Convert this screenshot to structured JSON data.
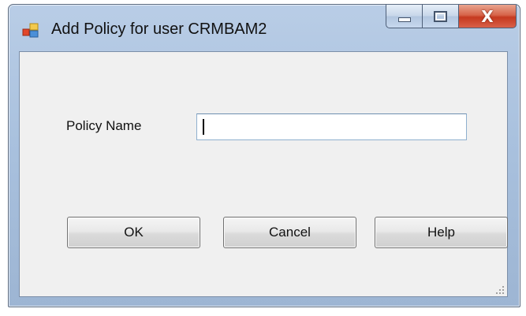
{
  "window": {
    "title": "Add Policy for user CRMBAM2"
  },
  "caption_buttons": {
    "minimize_icon": "minimize-icon",
    "maximize_icon": "maximize-icon",
    "close_icon": "close-icon",
    "close_glyph": "X"
  },
  "form": {
    "policy_label": "Policy Name",
    "policy_value": "",
    "policy_placeholder": ""
  },
  "buttons": {
    "ok_label": "OK",
    "cancel_label": "Cancel",
    "help_label": "Help"
  },
  "colors": {
    "frame": "#a9c1de",
    "client": "#f0f0f0",
    "close_button": "#c5391f"
  }
}
